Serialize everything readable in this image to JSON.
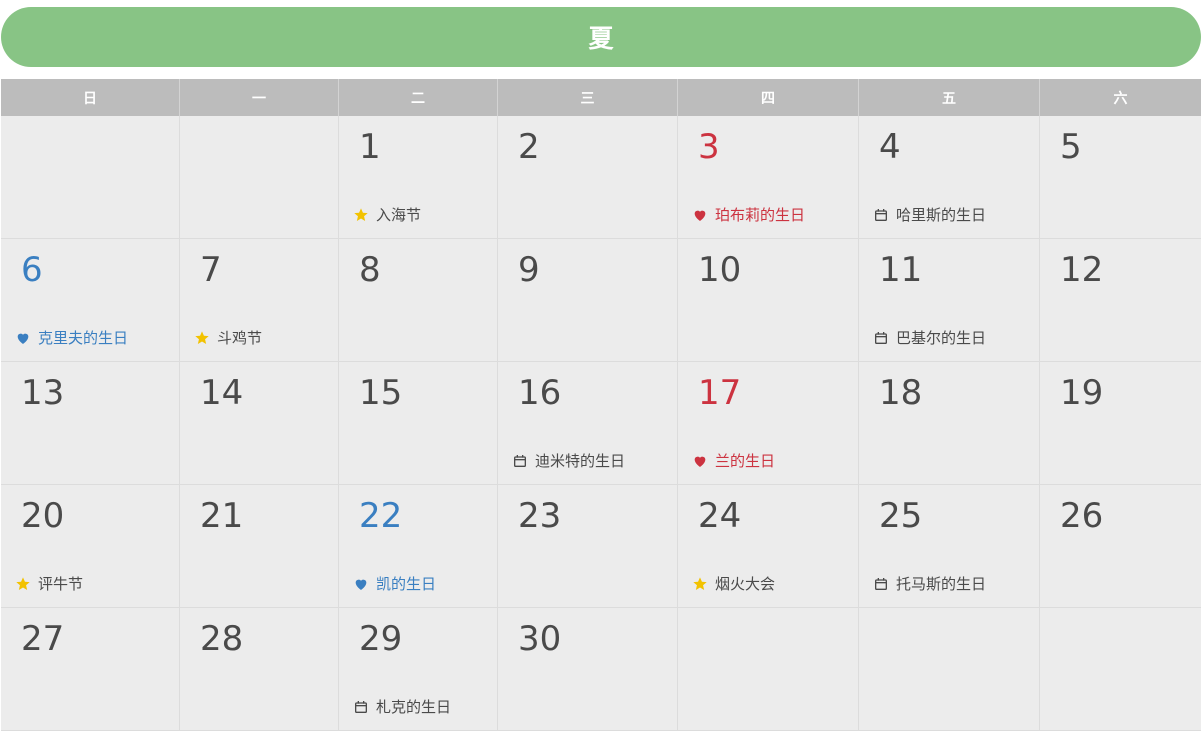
{
  "header": {
    "season": "夏"
  },
  "colors": {
    "header_bg": "#88c485",
    "weekday_bg": "#bcbcbc",
    "cell_bg": "#ececec",
    "red": "#cc3340",
    "blue": "#3a7fc1",
    "star": "#f2c200"
  },
  "weekdays": [
    "日",
    "一",
    "二",
    "三",
    "四",
    "五",
    "六"
  ],
  "cells": [
    {
      "day": "",
      "event": "",
      "icon": "",
      "tone": ""
    },
    {
      "day": "",
      "event": "",
      "icon": "",
      "tone": ""
    },
    {
      "day": "1",
      "event": "入海节",
      "icon": "star-icon",
      "tone": ""
    },
    {
      "day": "2",
      "event": "",
      "icon": "",
      "tone": ""
    },
    {
      "day": "3",
      "event": "珀布莉的生日",
      "icon": "heart-icon",
      "tone": "red"
    },
    {
      "day": "4",
      "event": "哈里斯的生日",
      "icon": "calendar-icon",
      "tone": ""
    },
    {
      "day": "5",
      "event": "",
      "icon": "",
      "tone": ""
    },
    {
      "day": "6",
      "event": "克里夫的生日",
      "icon": "heart-icon",
      "tone": "blue"
    },
    {
      "day": "7",
      "event": "斗鸡节",
      "icon": "star-icon",
      "tone": ""
    },
    {
      "day": "8",
      "event": "",
      "icon": "",
      "tone": ""
    },
    {
      "day": "9",
      "event": "",
      "icon": "",
      "tone": ""
    },
    {
      "day": "10",
      "event": "",
      "icon": "",
      "tone": ""
    },
    {
      "day": "11",
      "event": "巴基尔的生日",
      "icon": "calendar-icon",
      "tone": ""
    },
    {
      "day": "12",
      "event": "",
      "icon": "",
      "tone": ""
    },
    {
      "day": "13",
      "event": "",
      "icon": "",
      "tone": ""
    },
    {
      "day": "14",
      "event": "",
      "icon": "",
      "tone": ""
    },
    {
      "day": "15",
      "event": "",
      "icon": "",
      "tone": ""
    },
    {
      "day": "16",
      "event": "迪米特的生日",
      "icon": "calendar-icon",
      "tone": ""
    },
    {
      "day": "17",
      "event": "兰的生日",
      "icon": "heart-icon",
      "tone": "red"
    },
    {
      "day": "18",
      "event": "",
      "icon": "",
      "tone": ""
    },
    {
      "day": "19",
      "event": "",
      "icon": "",
      "tone": ""
    },
    {
      "day": "20",
      "event": "评牛节",
      "icon": "star-icon",
      "tone": ""
    },
    {
      "day": "21",
      "event": "",
      "icon": "",
      "tone": ""
    },
    {
      "day": "22",
      "event": "凯的生日",
      "icon": "heart-icon",
      "tone": "blue"
    },
    {
      "day": "23",
      "event": "",
      "icon": "",
      "tone": ""
    },
    {
      "day": "24",
      "event": "烟火大会",
      "icon": "star-icon",
      "tone": ""
    },
    {
      "day": "25",
      "event": "托马斯的生日",
      "icon": "calendar-icon",
      "tone": ""
    },
    {
      "day": "26",
      "event": "",
      "icon": "",
      "tone": ""
    },
    {
      "day": "27",
      "event": "",
      "icon": "",
      "tone": ""
    },
    {
      "day": "28",
      "event": "",
      "icon": "",
      "tone": ""
    },
    {
      "day": "29",
      "event": "札克的生日",
      "icon": "calendar-icon",
      "tone": ""
    },
    {
      "day": "30",
      "event": "",
      "icon": "",
      "tone": ""
    },
    {
      "day": "",
      "event": "",
      "icon": "",
      "tone": ""
    },
    {
      "day": "",
      "event": "",
      "icon": "",
      "tone": ""
    },
    {
      "day": "",
      "event": "",
      "icon": "",
      "tone": ""
    }
  ]
}
